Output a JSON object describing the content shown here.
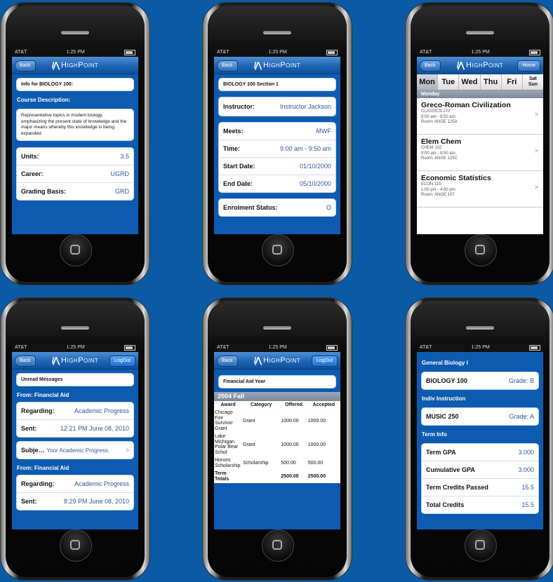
{
  "status": {
    "carrier": "AT&T",
    "time": "1:25 PM"
  },
  "brand": "HighPoint",
  "nav": {
    "back": "Back",
    "home": "Home",
    "logout": "LogOut"
  },
  "course_info": {
    "header": "Info for BIOLOGY 100:",
    "desc_title": "Course Description:",
    "description": "Representative topics in modern biology, emphasizing the present state of knowledge and the major means whereby this knowledge is being expanded.",
    "rows": [
      {
        "label": "Units:",
        "value": "3.5"
      },
      {
        "label": "Career:",
        "value": "UGRD"
      },
      {
        "label": "Grading Basis:",
        "value": "GRD"
      }
    ]
  },
  "section": {
    "header": "BIOLOGY 100 Section 1",
    "instructor": {
      "label": "Instructor:",
      "value": "Instructor Jackson"
    },
    "rows": [
      {
        "label": "Meets:",
        "value": "MWF"
      },
      {
        "label": "Time:",
        "value": "9:00 am - 9:50 am"
      },
      {
        "label": "Start Date:",
        "value": "01/10/2000"
      },
      {
        "label": "End Date:",
        "value": "05/10/2000"
      }
    ],
    "enrol": {
      "label": "Enrolment Status:",
      "value": "O"
    }
  },
  "schedule": {
    "days": [
      "Mon",
      "Tue",
      "Wed",
      "Thu",
      "Fri"
    ],
    "weekend": {
      "line1": "Sat",
      "line2": "Sun"
    },
    "day_label": "Monday",
    "courses": [
      {
        "title": "Greco-Roman Civilization",
        "code": "CLASSICS 270",
        "time": "9:00 am - 9:50 am",
        "room": "Room: ANGE 125A"
      },
      {
        "title": "Elem Chem",
        "code": "CHEM 102",
        "time": "9:00 am - 9:50 am",
        "room": "Room: ANGE 125C"
      },
      {
        "title": "Economic Statistics",
        "code": "ECON 115",
        "time": "1:00 pm - 4:00 pm",
        "room": "Room: ANGE 107"
      }
    ]
  },
  "messages": {
    "header": "Unread Messages",
    "groups": [
      {
        "from": "From: Financial Aid",
        "regarding_label": "Regarding:",
        "regarding": "Academic Progress",
        "sent_label": "Sent:",
        "sent": "12:21 PM June 08, 2010",
        "subject_label": "Subje…",
        "subject": "Your Academic Progress."
      },
      {
        "from": "From: Financial Aid",
        "regarding_label": "Regarding:",
        "regarding": "Academic Progress",
        "sent_label": "Sent:",
        "sent": "8:29 PM June 08, 2010"
      }
    ]
  },
  "financial": {
    "header": "Financial Aid Year",
    "term": "2004 Fall",
    "columns": [
      "Award",
      "Category",
      "Offered",
      "Accepted"
    ],
    "rows": [
      {
        "award": "Chicago Fire Survivor Grant",
        "category": "Grant",
        "offered": "1000.00",
        "accepted": "1000.00"
      },
      {
        "award": "Lake Michigan Polar Bear Schol",
        "category": "Grant",
        "offered": "1000.00",
        "accepted": "1000.00"
      },
      {
        "award": "Honors Scholarship",
        "category": "Scholarship",
        "offered": "500.00",
        "accepted": "500.00"
      }
    ],
    "totals": {
      "label": "Term Totals",
      "offered": "2500.00",
      "accepted": "2500.00"
    }
  },
  "grades": {
    "groups": [
      {
        "title": "General Biology I",
        "course": "BIOLOGY 100",
        "grade": "Grade: B"
      },
      {
        "title": "Indiv Instruction",
        "course": "MUSIC 250",
        "grade": "Grade: A"
      }
    ],
    "term_title": "Term Info",
    "term_rows": [
      {
        "label": "Term GPA",
        "value": "3.000"
      },
      {
        "label": "Cumulative GPA",
        "value": "3.000"
      },
      {
        "label": "Term Credits Passed",
        "value": "15.5"
      },
      {
        "label": "Total Credits",
        "value": "15.5"
      }
    ]
  }
}
